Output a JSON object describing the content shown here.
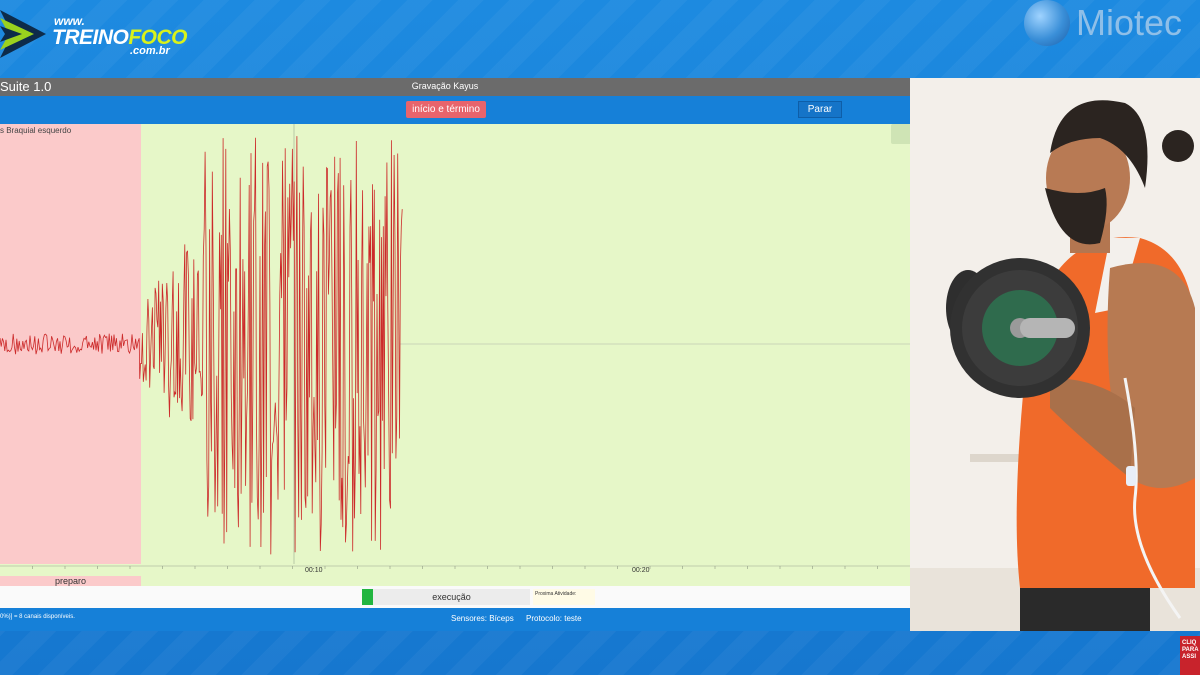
{
  "branding": {
    "logo_www": "www.",
    "logo_brand_main": "TREINO",
    "logo_brand_accent": "FOCO",
    "logo_domain": ".com.br",
    "partner": "Miotec"
  },
  "app": {
    "name": "Suite 1.0",
    "recording_title": "Gravação Kayus",
    "start_end_button": "início e término",
    "stop_button": "Parar",
    "channel_label": "s Braquial esquerdo",
    "time_ticks": [
      "00:10",
      "00:20"
    ],
    "prep_phase": "preparo",
    "current_phase": "execução",
    "next_activity": "Proxima Atividade:",
    "channels_info": "0%)] = 8 canais disponíveis.",
    "sensors": "Sensores: Bíceps",
    "protocol": "Protocolo: teste",
    "colors": {
      "prep_zone": "#fbcaca",
      "exec_zone": "#e6f7c8",
      "signal": "#cc2a2a",
      "toolbar": "#1680d8",
      "start_button": "#e8646c",
      "progress": "#22b540"
    }
  },
  "corner_badge": [
    "CLIQ",
    "PARA",
    "ASSI"
  ],
  "chart_data": {
    "type": "line",
    "xlabel": "",
    "ylabel": "",
    "x_ticks": [
      "00:10",
      "00:20"
    ],
    "series": [
      {
        "segments": [
          {
            "phase": "preparo",
            "x_range_s": [
              0,
              4.3
            ],
            "peak_amplitude": 0.05
          },
          {
            "phase": "execução",
            "x_range_s": [
              4.3,
              6.2
            ],
            "peak_amplitude": 0.6
          },
          {
            "phase": "execução",
            "x_range_s": [
              6.2,
              12.4
            ],
            "peak_amplitude": 1.0
          },
          {
            "phase": "execução",
            "x_range_s": [
              12.4,
              28
            ],
            "peak_amplitude": 0.0
          }
        ]
      }
    ],
    "xlim_s": [
      0,
      28
    ],
    "grid": false
  }
}
